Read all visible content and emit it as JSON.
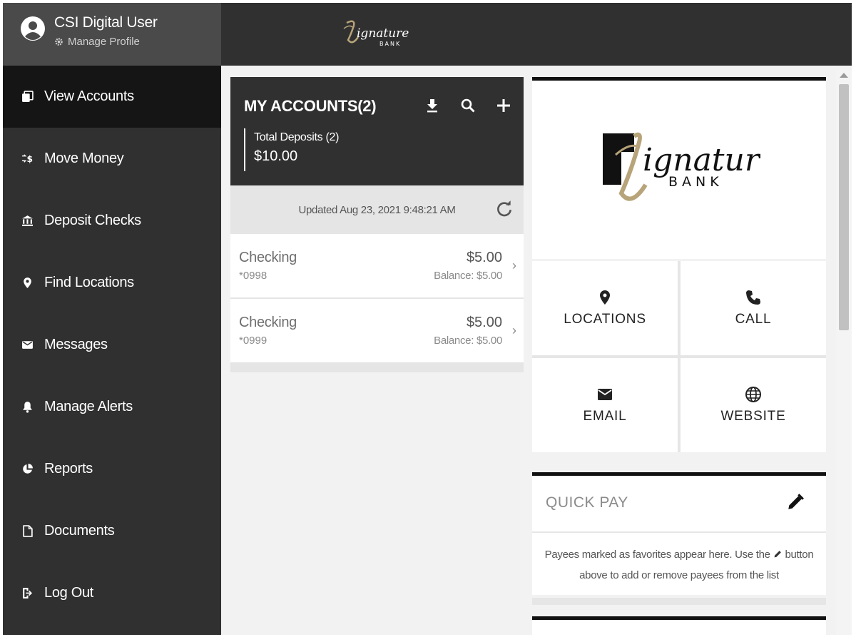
{
  "profile": {
    "name": "CSI Digital User",
    "manage_label": "Manage Profile"
  },
  "nav": {
    "items": [
      {
        "label": "View Accounts",
        "icon": "accounts-icon",
        "active": true
      },
      {
        "label": "Move Money",
        "icon": "transfer-money-icon"
      },
      {
        "label": "Deposit Checks",
        "icon": "bank-icon"
      },
      {
        "label": "Find Locations",
        "icon": "location-pin-icon"
      },
      {
        "label": "Messages",
        "icon": "envelope-icon"
      },
      {
        "label": "Manage Alerts",
        "icon": "bell-icon"
      },
      {
        "label": "Reports",
        "icon": "pie-chart-icon"
      },
      {
        "label": "Documents",
        "icon": "document-icon"
      },
      {
        "label": "Log Out",
        "icon": "logout-icon"
      }
    ]
  },
  "brand": {
    "name": "Signature",
    "sub": "BANK"
  },
  "accounts": {
    "title": "MY ACCOUNTS(2)",
    "total_label": "Total Deposits (2)",
    "total_amount": "$10.00",
    "updated": "Updated Aug 23, 2021 9:48:21 AM",
    "rows": [
      {
        "name": "Checking",
        "number": "*0998",
        "amount": "$5.00",
        "balance": "Balance: $5.00"
      },
      {
        "name": "Checking",
        "number": "*0999",
        "amount": "$5.00",
        "balance": "Balance: $5.00"
      }
    ]
  },
  "tiles": {
    "locations": "LOCATIONS",
    "call": "CALL",
    "email": "EMAIL",
    "website": "WEBSITE"
  },
  "quick_pay": {
    "title": "QUICK PAY",
    "text_before": "Payees marked as favorites appear here. Use the",
    "text_after": "button above to add or remove payees from the list"
  },
  "colors": {
    "sidebar": "#303030",
    "sidebar_active": "#151515",
    "profile_bg": "#4a4a4a",
    "gold": "#b8a47a"
  }
}
